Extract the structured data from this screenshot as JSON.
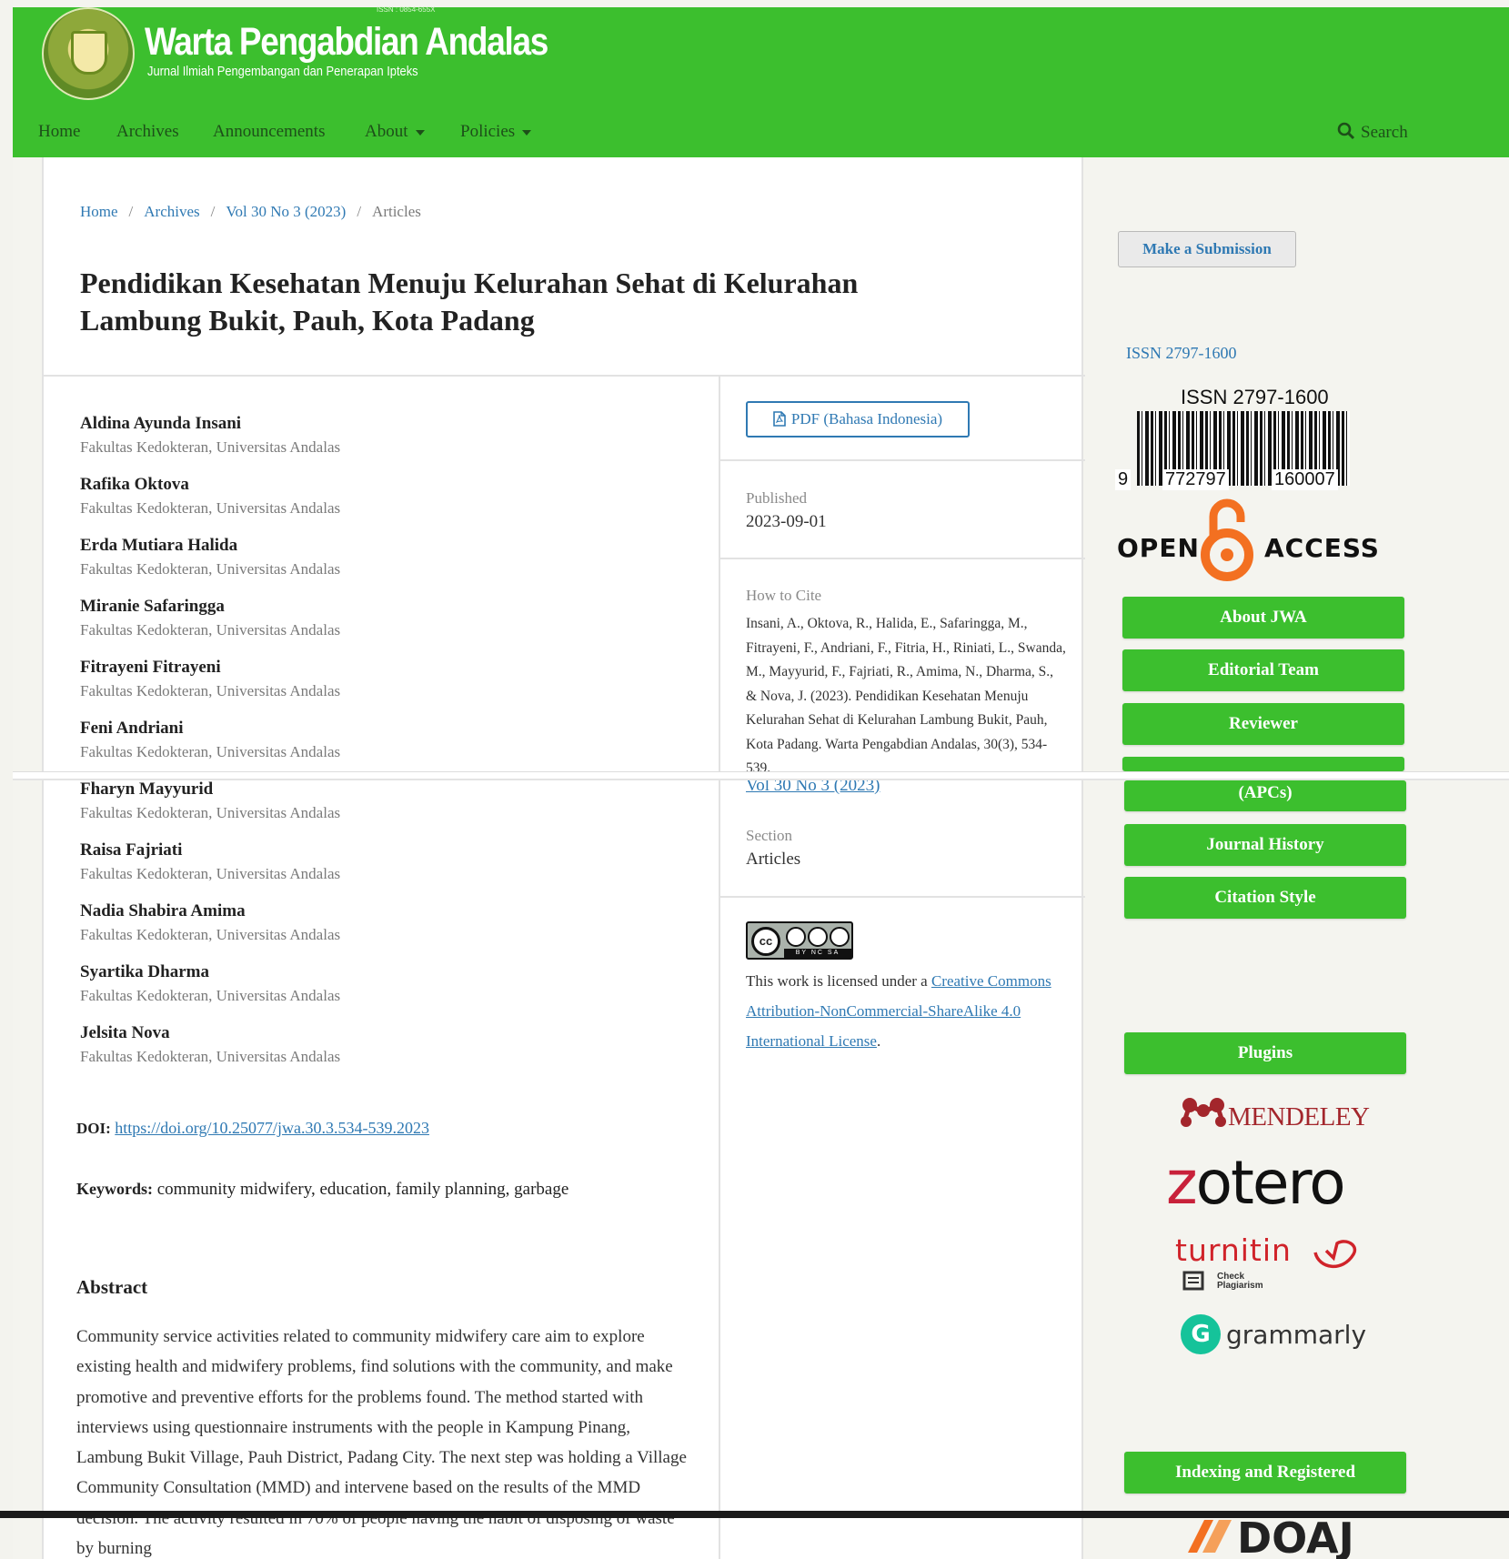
{
  "header": {
    "logo_issn": "ISSN : 0854-655X",
    "title": "Warta Pengabdian Andalas",
    "subtitle": "Jurnal Ilmiah Pengembangan dan Penerapan Ipteks",
    "nav": [
      {
        "label": "Home"
      },
      {
        "label": "Archives"
      },
      {
        "label": "Announcements"
      },
      {
        "label": "About"
      },
      {
        "label": "Policies"
      }
    ],
    "search_label": "Search",
    "brand_color": "#3cbf2e"
  },
  "breadcrumb": {
    "items": [
      "Home",
      "Archives",
      "Vol 30 No 3 (2023)"
    ],
    "current": "Articles"
  },
  "article": {
    "title_line1": "Pendidikan Kesehatan Menuju Kelurahan Sehat di Kelurahan",
    "title_line2": "Lambung Bukit, Pauh, Kota Padang",
    "authors": [
      {
        "name": "Aldina Ayunda Insani",
        "affiliation": "Fakultas Kedokteran, Universitas Andalas"
      },
      {
        "name": "Rafika Oktova",
        "affiliation": "Fakultas Kedokteran, Universitas Andalas"
      },
      {
        "name": "Erda Mutiara Halida",
        "affiliation": "Fakultas Kedokteran, Universitas Andalas"
      },
      {
        "name": "Miranie Safaringga",
        "affiliation": "Fakultas Kedokteran, Universitas Andalas"
      },
      {
        "name": "Fitrayeni Fitrayeni",
        "affiliation": "Fakultas Kedokteran, Universitas Andalas"
      },
      {
        "name": "Feni Andriani",
        "affiliation": "Fakultas Kedokteran, Universitas Andalas"
      },
      {
        "name": "Fharyn Mayyurid",
        "affiliation": "Fakultas Kedokteran, Universitas Andalas"
      },
      {
        "name": "Raisa Fajriati",
        "affiliation": "Fakultas Kedokteran, Universitas Andalas"
      },
      {
        "name": "Nadia Shabira Amima",
        "affiliation": "Fakultas Kedokteran, Universitas Andalas"
      },
      {
        "name": "Syartika Dharma",
        "affiliation": "Fakultas Kedokteran, Universitas Andalas"
      },
      {
        "name": "Jelsita Nova",
        "affiliation": "Fakultas Kedokteran, Universitas Andalas"
      }
    ],
    "doi_label": "DOI:",
    "doi_url": "https://doi.org/10.25077/jwa.30.3.534-539.2023",
    "keywords_label": "Keywords:",
    "keywords": "community midwifery, education, family planning, garbage",
    "abstract_heading": "Abstract",
    "abstract_text": "Community service activities related to community midwifery care aim to explore existing health and midwifery problems, find solutions with the community, and make promotive and preventive efforts for the problems found. The method started with interviews using questionnaire instruments with the people in Kampung Pinang, Lambung Bukit Village, Pauh District, Padang City. The next step was holding a Village Community Consultation (MMD) and intervene based on the results of the MMD decision. The activity resulted in 70% of people having the habit of disposing of waste by burning"
  },
  "details": {
    "pdf_label": "PDF (Bahasa Indonesia)",
    "published_label": "Published",
    "published_value": "2023-09-01",
    "cite_label": "How to Cite",
    "cite_text": "Insani, A., Oktova, R., Halida, E., Safaringga, M., Fitrayeni, F., Andriani, F., Fitria, H., Riniati, L., Swanda, M., Mayyurid, F., Fajriati, R., Amima, N., Dharma, S., & Nova, J. (2023). Pendidikan Kesehatan Menuju Kelurahan Sehat di Kelurahan Lambung Bukit, Pauh, Kota Padang. Warta Pengabdian Andalas, 30(3), 534-539.",
    "issue_link": "Vol 30 No 3 (2023)",
    "section_label": "Section",
    "section_value": "Articles",
    "cc_badge_text": "BY NC SA",
    "license_prefix": "This work is licensed under a ",
    "license_link": "Creative Commons Attribution-NonCommercial-ShareAlike 4.0 International License",
    "license_suffix": "."
  },
  "sidebar": {
    "submit_label": "Make a Submission",
    "issn_link": "ISSN 2797-1600",
    "barcode_title": "ISSN 2797-1600",
    "barcode_left": "9",
    "barcode_mid": "772797",
    "barcode_right": "160007",
    "open_access_left": "OPEN",
    "open_access_right": "ACCESS",
    "buttons": [
      "About JWA",
      "Editorial Team",
      "Reviewer",
      "",
      "(APCs)",
      "Journal History",
      "Citation Style"
    ],
    "plugins_label": "Plugins",
    "mendeley": "MENDELEY",
    "zotero_z": "z",
    "zotero_rest": "otero",
    "turnitin": "turnitin",
    "turnitin_sub1": "Check",
    "turnitin_sub2": "Plagiarism",
    "grammarly_g": "G",
    "grammarly": "grammarly",
    "indexing_label": "Indexing and Registered",
    "doaj": "DOAJ"
  }
}
